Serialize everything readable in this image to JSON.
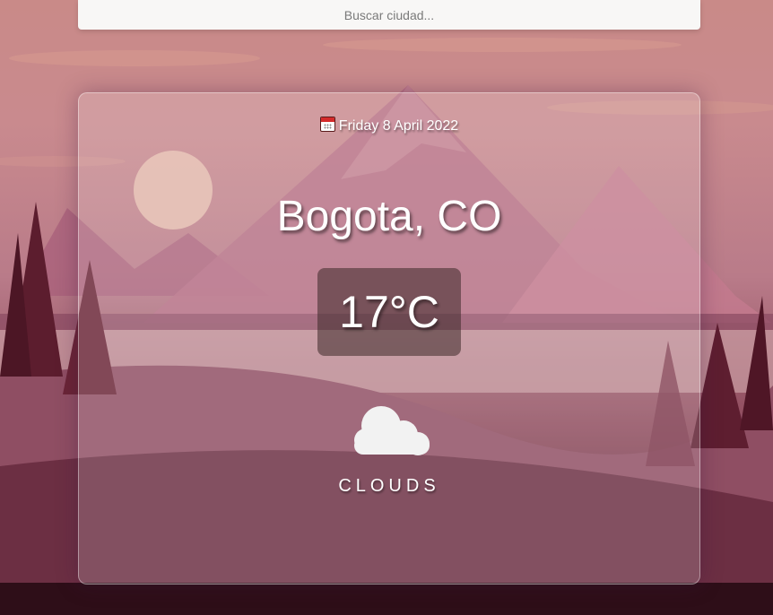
{
  "search": {
    "placeholder": "Buscar ciudad..."
  },
  "weather": {
    "date": "Friday 8 April 2022",
    "date_icon": "calendar-icon",
    "city": "Bogota, CO",
    "temperature": "17°C",
    "condition": "CLOUDS",
    "condition_icon": "cloud-icon"
  },
  "colors": {
    "text": "#ffffff",
    "search_bg": "#f8f7f6",
    "temp_box_bg": "#3c2828",
    "background_top": "#c98a88",
    "background_bottom": "#52222f"
  }
}
